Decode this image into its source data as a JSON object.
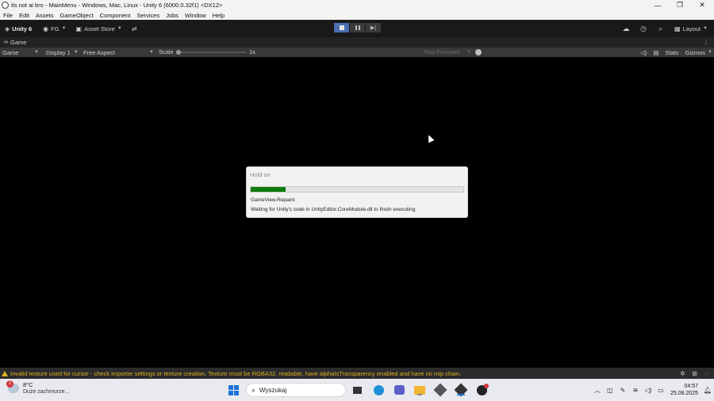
{
  "window": {
    "title": "its not ai bro - MainMenu - Windows, Mac, Linux - Unity 6 (6000.0.32f1) <DX12>",
    "controls": {
      "minimize": "—",
      "maximize": "❐",
      "close": "✕"
    }
  },
  "menu": {
    "items": [
      {
        "label": "File"
      },
      {
        "label": "Edit"
      },
      {
        "label": "Assets"
      },
      {
        "label": "GameObject"
      },
      {
        "label": "Component"
      },
      {
        "label": "Services"
      },
      {
        "label": "Jobs"
      },
      {
        "label": "Window"
      },
      {
        "label": "Help"
      }
    ]
  },
  "toolbar": {
    "unity_label": "Unity 6",
    "account_label": "FG",
    "asset_store_label": "Asset Store",
    "layout_label": "Layout"
  },
  "tab": {
    "label": "Game"
  },
  "gamebar": {
    "mode": "Game",
    "display": "Display 1",
    "aspect": "Free Aspect",
    "scale_label": "Scale",
    "scale_value": "1x",
    "play_focused": "Play Focused",
    "stats": "Stats",
    "gizmos": "Gizmos"
  },
  "dialog": {
    "title": "Hold on",
    "progress": 0.165,
    "text1": "GameView.Repaint",
    "text2": "Waiting for Unity's code in UnityEditor.CoreModule.dll to finish executing."
  },
  "console": {
    "message": "Invalid texture used for cursor - check importer settings or texture creation. Texture must be RGBA32, readable, have alphaIsTransparency enabled and have no mip chain."
  },
  "taskbar": {
    "weather_badge": "2",
    "weather_temp": "8°C",
    "weather_desc": "Duże zachmurze...",
    "search_placeholder": "Wyszukaj",
    "time": "04:57",
    "date": "25.08.2025"
  },
  "colors": {
    "progress_fill": "#0f7b0f",
    "warning": "#e0b020",
    "play_active": "#4a6fb0"
  }
}
